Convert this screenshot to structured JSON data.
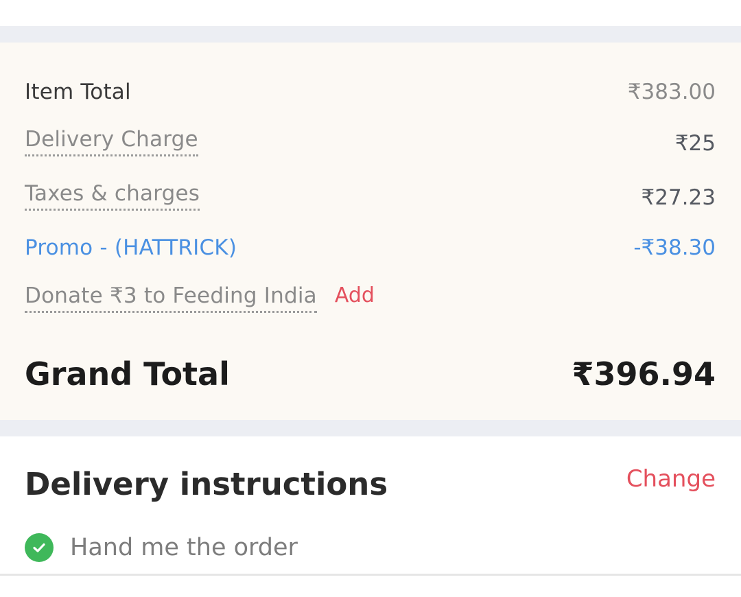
{
  "bill": {
    "item_total_label": "Item Total",
    "item_total_value": "₹383.00",
    "delivery_charge_label": "Delivery Charge",
    "delivery_charge_value": "₹25",
    "taxes_label": "Taxes & charges",
    "taxes_value": "₹27.23",
    "promo_label": "Promo - (HATTRICK)",
    "promo_value": "-₹38.30",
    "donate_label": "Donate ₹3 to Feeding India",
    "donate_add_label": "Add",
    "grand_total_label": "Grand Total",
    "grand_total_value": "₹396.94"
  },
  "delivery_instructions": {
    "title": "Delivery instructions",
    "change_label": "Change",
    "items": [
      {
        "label": "Hand me the order",
        "icon": "check-circle-icon"
      }
    ]
  },
  "colors": {
    "accent_red": "#e4505d",
    "promo_blue": "#4a90e2",
    "check_green": "#3fb85a",
    "bill_background": "#fcf9f4",
    "divider": "#eceef3"
  }
}
